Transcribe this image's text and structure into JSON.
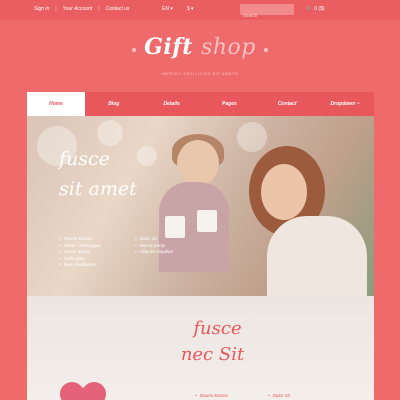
{
  "topbar": {
    "links": [
      "Sign in",
      "Your Account",
      "Contact us"
    ],
    "separator": "|",
    "language": "EN",
    "currency": "$",
    "search_placeholder": "Search",
    "cart_count": "0 ($)"
  },
  "logo": {
    "word1": "Gift",
    "word2": "shop",
    "tagline": "IMPEDIT FACILITIES SIT AMETS"
  },
  "nav": [
    "Home",
    "Blog",
    "Details",
    "Pages",
    "Contact",
    "Dropdown ~"
  ],
  "hero1": {
    "title_line1": "fusce",
    "title_line2": "sit amet",
    "list_left": [
      "Mauris Massa",
      "Tellus - Sed augue",
      "Lorem Ipsum",
      "Nulla Quis",
      "Duis Vestibulum"
    ],
    "list_right": [
      "Dolor Sit",
      "Sed ut persp",
      "Aliquam dapibus"
    ]
  },
  "hero2": {
    "title_line1": "fusce",
    "title_line2": "nec Sit",
    "list_left": [
      "Mauris Massa"
    ],
    "list_right": [
      "Dolor Sit"
    ]
  },
  "colors": {
    "background": "#ee6a6b",
    "accent": "#e8575c",
    "light": "#f8c2c3"
  }
}
